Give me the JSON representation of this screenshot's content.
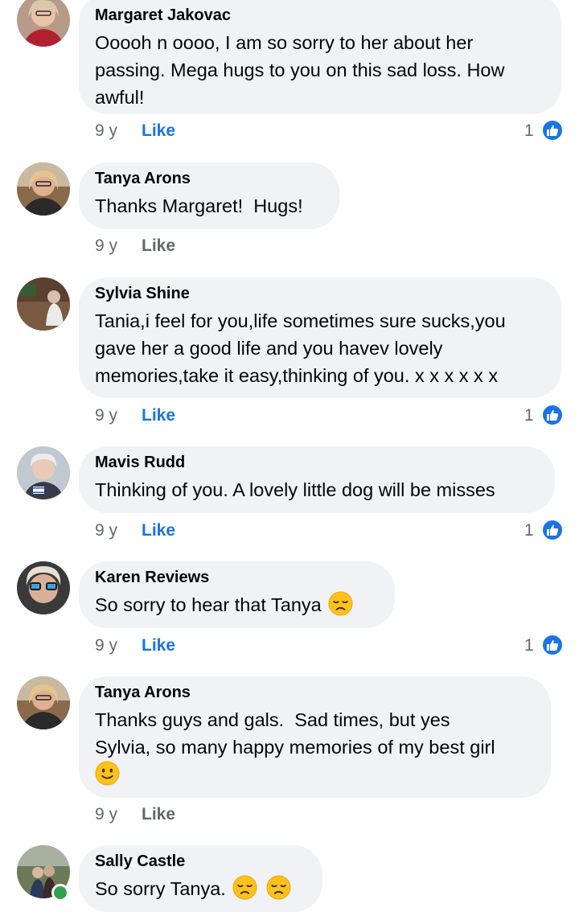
{
  "colors": {
    "accent": "#1b74e4",
    "bubble": "#f0f2f5",
    "meta": "#65676b",
    "online": "#31a24c"
  },
  "comments": [
    {
      "author": "Margaret Jakovac",
      "line1": "Ooooh n oooo, I am so sorry to her about her",
      "line2": "passing. Mega hugs to you on this sad loss. How",
      "line3": "awful!",
      "age": "9 y",
      "like_label": "Like",
      "reaction_count": "1"
    },
    {
      "author": "Tanya Arons",
      "line1": "Thanks Margaret!  Hugs!",
      "age": "9 y",
      "like_label": "Like"
    },
    {
      "author": "Sylvia Shine",
      "line1": "Tania,i feel for you,life sometimes sure sucks,you",
      "line2": "gave her a good life and you havev lovely",
      "line3": "memories,take it easy,thinking of you. x x x x x x",
      "age": "9 y",
      "like_label": "Like",
      "reaction_count": "1"
    },
    {
      "author": "Mavis Rudd",
      "line1": "Thinking of you. A lovely little dog will be misses",
      "age": "9 y",
      "like_label": "Like",
      "reaction_count": "1"
    },
    {
      "author": "Karen Reviews",
      "line1": "So sorry to hear that Tanya",
      "emoji": "disappointed-face",
      "age": "9 y",
      "like_label": "Like",
      "reaction_count": "1"
    },
    {
      "author": "Tanya Arons",
      "line1": "Thanks guys and gals.  Sad times, but yes",
      "line2": "Sylvia, so many happy memories of my best girl",
      "emoji": "slightly-smiling-face",
      "age": "9 y",
      "like_label": "Like"
    },
    {
      "author": "Sally Castle",
      "line1": "So sorry Tanya.",
      "emoji": "disappointed-face",
      "online": true
    }
  ],
  "icons": {
    "reaction": "thumbs-up-icon"
  }
}
